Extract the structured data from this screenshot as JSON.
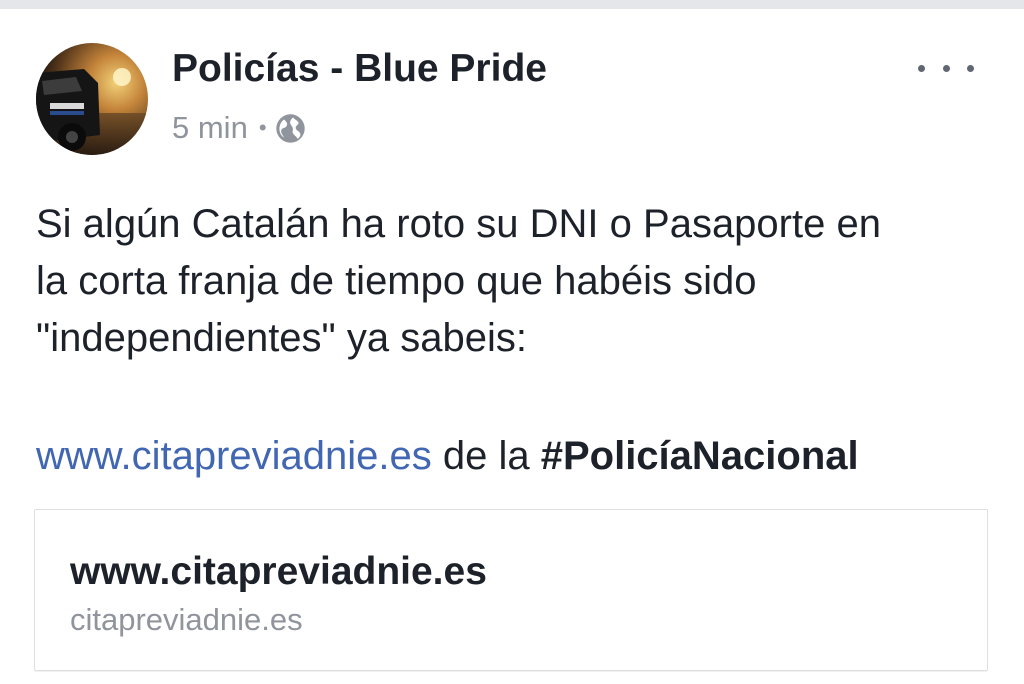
{
  "post": {
    "author": "Policías - Blue Pride",
    "timestamp": "5 min",
    "separator": "•",
    "audience_icon": "globe-icon",
    "more_icon": "more-horizontal-icon",
    "body_lines": [
      "Si algún Catalán ha roto su DNI o Pasaporte en",
      "la corta franja de tiempo que habéis sido",
      "\"independientes\" ya sabeis:"
    ],
    "link_text": "www.citapreviadnie.es",
    "link_suffix": " de la ",
    "hashtag": "#PolicíaNacional"
  },
  "link_preview": {
    "title": "www.citapreviadnie.es",
    "domain": "citapreviadnie.es"
  },
  "colors": {
    "link": "#4267b2",
    "text": "#1d2129",
    "meta": "#90949c",
    "border": "#dddfe2"
  }
}
